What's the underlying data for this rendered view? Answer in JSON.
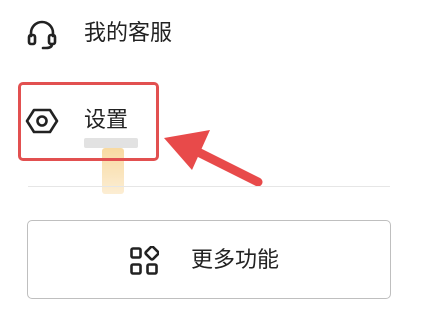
{
  "menu": {
    "service": {
      "label": "我的客服",
      "icon": "headset-icon"
    },
    "settings": {
      "label": "设置",
      "icon": "hexagon-settings-icon"
    }
  },
  "more_button": {
    "label": "更多功能",
    "icon": "grid-apps-icon"
  },
  "colors": {
    "highlight": "#e25050",
    "arrow": "#e84a4a",
    "text": "#222222",
    "border": "#bfbfbf",
    "divider": "#e6e6e6"
  }
}
